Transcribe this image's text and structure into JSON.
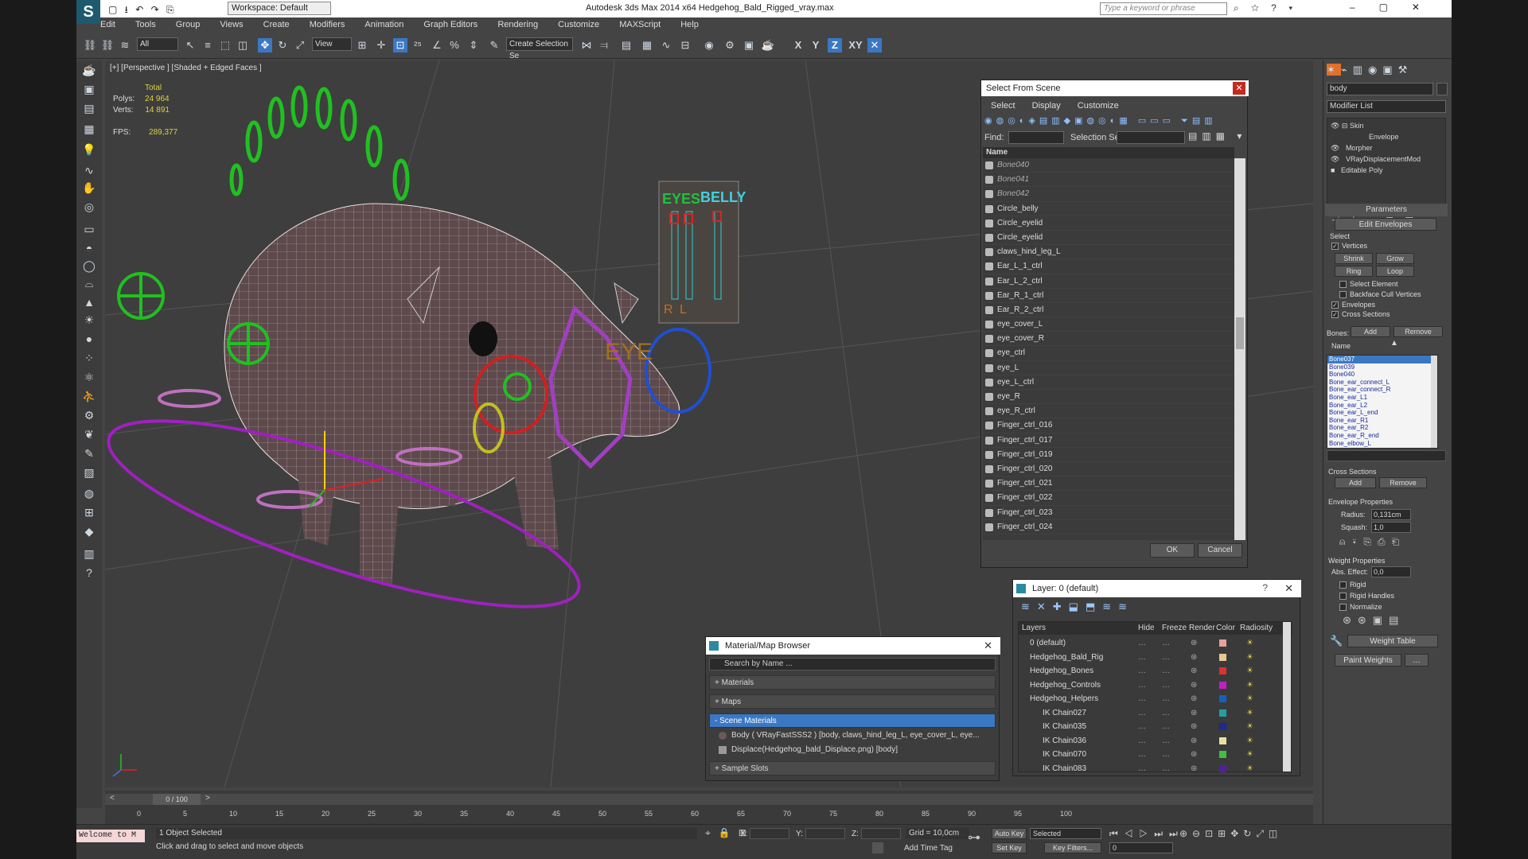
{
  "titlebar": {
    "workspace": "Workspace: Default",
    "title": "Autodesk 3ds Max  2014 x64     Hedgehog_Bald_Rigged_vray.max",
    "search_placeholder": "Type a keyword or phrase"
  },
  "menu": [
    "Edit",
    "Tools",
    "Group",
    "Views",
    "Create",
    "Modifiers",
    "Animation",
    "Graph Editors",
    "Rendering",
    "Customize",
    "MAXScript",
    "Help"
  ],
  "toolbar": {
    "filter": "All",
    "ref_coord": "View",
    "selection_set": "Create Selection Se",
    "axes": [
      "X",
      "Y",
      "Z",
      "XY"
    ]
  },
  "viewport": {
    "label": "[+] [Perspective ] [Shaded + Edged Faces ]",
    "stats_total": "Total",
    "polys_label": "Polys:",
    "polys_value": "24 964",
    "verts_label": "Verts:",
    "verts_value": "14 891",
    "fps_label": "FPS:",
    "fps_value": "289,377",
    "panel_text": {
      "eyes": "EYES",
      "belly": "BELLY",
      "r": "R",
      "l": "L",
      "eye": "EYE"
    }
  },
  "select_from_scene": {
    "title": "Select From Scene",
    "menus": [
      "Select",
      "Display",
      "Customize"
    ],
    "find_label": "Find:",
    "selection_set_label": "Selection Set:",
    "column_name": "Name",
    "rows": [
      {
        "name": "Bone040",
        "dim": true
      },
      {
        "name": "Bone041",
        "dim": true
      },
      {
        "name": "Bone042",
        "dim": true
      },
      {
        "name": "Circle_belly"
      },
      {
        "name": "Circle_eyelid"
      },
      {
        "name": "Circle_eyelid"
      },
      {
        "name": "claws_hind_leg_L"
      },
      {
        "name": "Ear_L_1_ctrl"
      },
      {
        "name": "Ear_L_2_ctrl"
      },
      {
        "name": "Ear_R_1_ctrl"
      },
      {
        "name": "Ear_R_2_ctrl"
      },
      {
        "name": "eye_cover_L"
      },
      {
        "name": "eye_cover_R"
      },
      {
        "name": "eye_ctrl"
      },
      {
        "name": "eye_L"
      },
      {
        "name": "eye_L_ctrl"
      },
      {
        "name": "eye_R"
      },
      {
        "name": "eye_R_ctrl"
      },
      {
        "name": "Finger_ctrl_016"
      },
      {
        "name": "Finger_ctrl_017"
      },
      {
        "name": "Finger_ctrl_019"
      },
      {
        "name": "Finger_ctrl_020"
      },
      {
        "name": "Finger_ctrl_021"
      },
      {
        "name": "Finger_ctrl_022"
      },
      {
        "name": "Finger_ctrl_023"
      },
      {
        "name": "Finger_ctrl_024"
      }
    ],
    "ok": "OK",
    "cancel": "Cancel"
  },
  "material_browser": {
    "title": "Material/Map Browser",
    "search_placeholder": "Search by Name ...",
    "materials": "+ Materials",
    "maps": "+ Maps",
    "scene_materials": "- Scene Materials",
    "item1": "Body  ( VRayFastSSS2 ) [body, claws_hind_leg_L, eye_cover_L, eye...",
    "item2": "Displace(Hedgehog_bald_Displace.png) [body]",
    "sample_slots": "+ Sample Slots"
  },
  "layer_manager": {
    "title": "Layer: 0 (default)",
    "columns": [
      "Layers",
      "Hide",
      "Freeze",
      "Render",
      "Color",
      "Radiosity"
    ],
    "rows": [
      {
        "name": "0 (default)",
        "color": "#e8a0a0"
      },
      {
        "name": "Hedgehog_Bald_Rig",
        "color": "#e8c890"
      },
      {
        "name": "Hedgehog_Bones",
        "color": "#e03030"
      },
      {
        "name": "Hedgehog_Controls",
        "color": "#c020c0"
      },
      {
        "name": "Hedgehog_Helpers",
        "color": "#1060c0"
      },
      {
        "name": "IK Chain027",
        "color": "#20a0a0"
      },
      {
        "name": "IK Chain035",
        "color": "#1a2a9a"
      },
      {
        "name": "IK Chain036",
        "color": "#e8e0a0"
      },
      {
        "name": "IK Chain070",
        "color": "#40c040"
      },
      {
        "name": "IK Chain083",
        "color": "#5020a0"
      }
    ]
  },
  "command_panel": {
    "object_name": "body",
    "modifier_list": "Modifier List",
    "stack": [
      "Skin",
      "Envelope",
      "Morpher",
      "VRayDisplacementMod",
      "Editable Poly"
    ],
    "parameters": "Parameters",
    "edit_envelopes": "Edit Envelopes",
    "select_label": "Select",
    "vertices": "Vertices",
    "shrink": "Shrink",
    "grow": "Grow",
    "ring": "Ring",
    "loop": "Loop",
    "select_element": "Select Element",
    "backface_cull": "Backface Cull Vertices",
    "envelopes": "Envelopes",
    "cross_sections": "Cross Sections",
    "bones_label": "Bones:",
    "add": "Add",
    "remove": "Remove",
    "name_col": "Name",
    "bones": [
      "Bone037",
      "Bone039",
      "Bone040",
      "Bone_ear_connect_L",
      "Bone_ear_connect_R",
      "Bone_ear_L1",
      "Bone_ear_L2",
      "Bone_ear_L_end",
      "Bone_ear_R1",
      "Bone_ear_R2",
      "Bone_ear_R_end",
      "Bone_elbow_L"
    ],
    "cross_sections_group": "Cross Sections",
    "envelope_props": "Envelope Properties",
    "radius_label": "Radius:",
    "radius_value": "0,131cm",
    "squash_label": "Squash:",
    "squash_value": "1,0",
    "weight_props": "Weight Properties",
    "abs_effect_label": "Abs. Effect:",
    "abs_effect_value": "0,0",
    "rigid": "Rigid",
    "rigid_handles": "Rigid Handles",
    "normalize": "Normalize",
    "weight_table": "Weight Table",
    "paint_weights": "Paint Weights"
  },
  "timeline": {
    "frame": "0 / 100",
    "ticks": [
      "0",
      "5",
      "10",
      "15",
      "20",
      "25",
      "30",
      "35",
      "40",
      "45",
      "50",
      "55",
      "60",
      "65",
      "70",
      "75",
      "80",
      "85",
      "90",
      "95",
      "100"
    ]
  },
  "status": {
    "script": "Welcome to M",
    "selected": "1 Object Selected",
    "prompt": "Click and drag to select and move objects",
    "x_label": "X:",
    "y_label": "Y:",
    "z_label": "Z:",
    "grid": "Grid = 10,0cm",
    "add_time_tag": "Add Time Tag",
    "auto_key": "Auto Key",
    "set_key": "Set Key",
    "key_mode": "Selected",
    "key_filters": "Key Filters...",
    "frame_value": "0"
  }
}
